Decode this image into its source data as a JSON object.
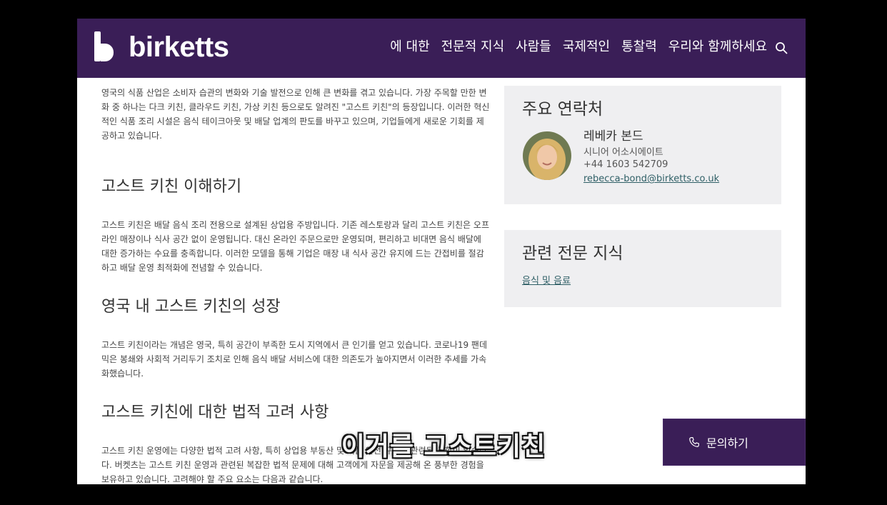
{
  "header": {
    "logo_text": "birketts",
    "nav": [
      "에 대한",
      "전문적 지식",
      "사람들",
      "국제적인",
      "통찰력",
      "우리와 함께하세요"
    ]
  },
  "article": {
    "intro": "영국의 식품 산업은 소비자 습관의 변화와 기술 발전으로 인해 큰 변화를 겪고 있습니다. 가장 주목할 만한 변화 중 하나는 다크 키친, 클라우드 키친, 가상 키친 등으로도 알려진 \"고스트 키친\"의 등장입니다. 이러한 혁신적인 식품 조리 시설은 음식 테이크아웃 및 배달 업계의 판도를 바꾸고 있으며, 기업들에게 새로운 기회를 제공하고 있습니다.",
    "sections": [
      {
        "heading": "고스트 키친 이해하기",
        "body": "고스트 키친은 배달 음식 조리 전용으로 설계된 상업용 주방입니다. 기존 레스토랑과 달리 고스트 키친은 오프라인 매장이나 식사 공간 없이 운영됩니다. 대신 온라인 주문으로만 운영되며, 편리하고 비대면 음식 배달에 대한 증가하는 수요를 충족합니다. 이러한 모델을 통해 기업은 매장 내 식사 공간 유지에 드는 간접비를 절감하고 배달 운영 최적화에 전념할 수 있습니다."
      },
      {
        "heading": "영국 내 고스트 키친의 성장",
        "body": "고스트 키친이라는 개념은 영국, 특히 공간이 부족한 도시 지역에서 큰 인기를 얻고 있습니다. 코로나19 팬데믹은 봉쇄와 사회적 거리두기 조치로 인해 음식 배달 서비스에 대한 의존도가 높아지면서 이러한 추세를 가속화했습니다."
      },
      {
        "heading": "고스트 키친에 대한 법적 고려 사항",
        "body": "고스트 키친 운영에는 다양한 법적 고려 사항, 특히 상업용 부동산 및 식품 안전 규정과 관련된 사항이 있습니다. 버켓츠는 고스트 키친 운영과 관련된 복잡한 법적 문제에 대해 고객에게 자문을 제공해 온 풍부한 경험을 보유하고 있습니다. 고려해야 할 주요 요소는 다음과 같습니다."
      }
    ]
  },
  "sidebar": {
    "contact_title": "주요 연락처",
    "contact": {
      "name": "레베카 본드",
      "role": "시니어 어소시에이트",
      "phone": "+44 1603 542709",
      "email": "rebecca-bond@birketts.co.uk"
    },
    "expertise_title": "관련 전문 지식",
    "expertise_link": "음식 및 음료"
  },
  "inquiry_button": "문의하기",
  "caption": "이거를 고스트키친",
  "colors": {
    "brand": "#3a1e57",
    "link": "#2f5f66",
    "card": "#efeff1"
  }
}
